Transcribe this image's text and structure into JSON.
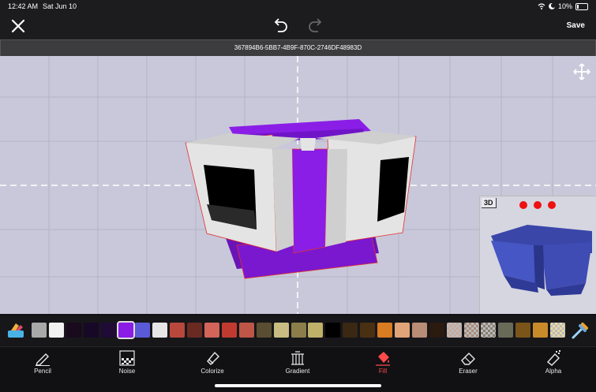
{
  "status": {
    "time": "12:42 AM",
    "date": "Sat Jun 10",
    "battery": "10%"
  },
  "toolbar": {
    "save_label": "Save"
  },
  "asset_id": "367894B6-5BB7-4B9F-870C-2746DF48983D",
  "preview": {
    "mode_label": "3D"
  },
  "colors": {
    "background": "#c8c8da",
    "model_primary": "#8a1ee6",
    "model_secondary": "#e6e6e6",
    "selected_tool": "#ff4a4a"
  },
  "palette": [
    {
      "color": "#a8a8a8"
    },
    {
      "color": "#f2f2f2"
    },
    {
      "color": "#1a0a1e"
    },
    {
      "color": "#180828"
    },
    {
      "color": "#200a36"
    },
    {
      "color": "#8a1ee6",
      "selected": true
    },
    {
      "color": "#5a5ad8"
    },
    {
      "color": "#e6e6e6"
    },
    {
      "color": "#b8483c"
    },
    {
      "color": "#6a2a22"
    },
    {
      "color": "#d2645a"
    },
    {
      "color": "#c03a30"
    },
    {
      "color": "#be5648"
    },
    {
      "color": "#5a4e32"
    },
    {
      "color": "#c8bc82"
    },
    {
      "color": "#8c7e4a"
    },
    {
      "color": "#bfb06a"
    },
    {
      "color": "#000000"
    },
    {
      "color": "#3a2814"
    },
    {
      "color": "#4a3012"
    },
    {
      "color": "#d97c22"
    },
    {
      "color": "#e0a478"
    },
    {
      "color": "#b98c76"
    },
    {
      "color": "#2a1a10"
    },
    {
      "color": "#c9a99a",
      "checker": true
    },
    {
      "color": "#a88a78",
      "checker": true
    },
    {
      "color": "#8a7e70",
      "checker": true
    },
    {
      "color": "#6a6a58"
    },
    {
      "color": "#7a5418"
    },
    {
      "color": "#c98a2a"
    },
    {
      "color": "#e8d8a2",
      "checker": true
    }
  ],
  "tools": [
    {
      "label": "Pencil",
      "icon": "pencil-icon"
    },
    {
      "label": "Noise",
      "icon": "noise-icon"
    },
    {
      "label": "Colorize",
      "icon": "colorize-icon"
    },
    {
      "label": "Gradient",
      "icon": "gradient-icon"
    },
    {
      "label": "Fill",
      "icon": "fill-bucket-icon",
      "active": true
    },
    {
      "label": "Eraser",
      "icon": "eraser-icon"
    },
    {
      "label": "Alpha",
      "icon": "alpha-icon"
    }
  ]
}
